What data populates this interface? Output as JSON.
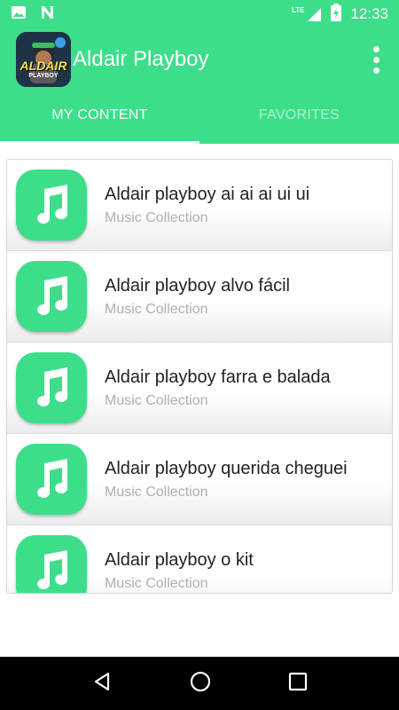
{
  "status_bar": {
    "time": "12:33",
    "network": "LTE",
    "icons": [
      "photo-icon",
      "n-icon",
      "lte-icon",
      "signal-icon",
      "battery-icon"
    ]
  },
  "app_bar": {
    "title": "Aldair Playboy",
    "logo_text": "ALDAIR",
    "logo_subtext": "PLAYBOY"
  },
  "tabs": [
    {
      "label": "MY CONTENT",
      "active": true
    },
    {
      "label": "FAVORITES",
      "active": false
    }
  ],
  "list": {
    "items": [
      {
        "title": "Aldair playboy ai ai ai ui ui",
        "subtitle": "Music Collection"
      },
      {
        "title": "Aldair playboy alvo fácil",
        "subtitle": "Music Collection"
      },
      {
        "title": "Aldair playboy farra e balada",
        "subtitle": "Music Collection"
      },
      {
        "title": "Aldair playboy querida cheguei",
        "subtitle": "Music Collection"
      },
      {
        "title": "Aldair playboy o kit",
        "subtitle": "Music Collection"
      }
    ]
  },
  "colors": {
    "accent": "#3dde8a",
    "nav_bar": "#000000"
  }
}
